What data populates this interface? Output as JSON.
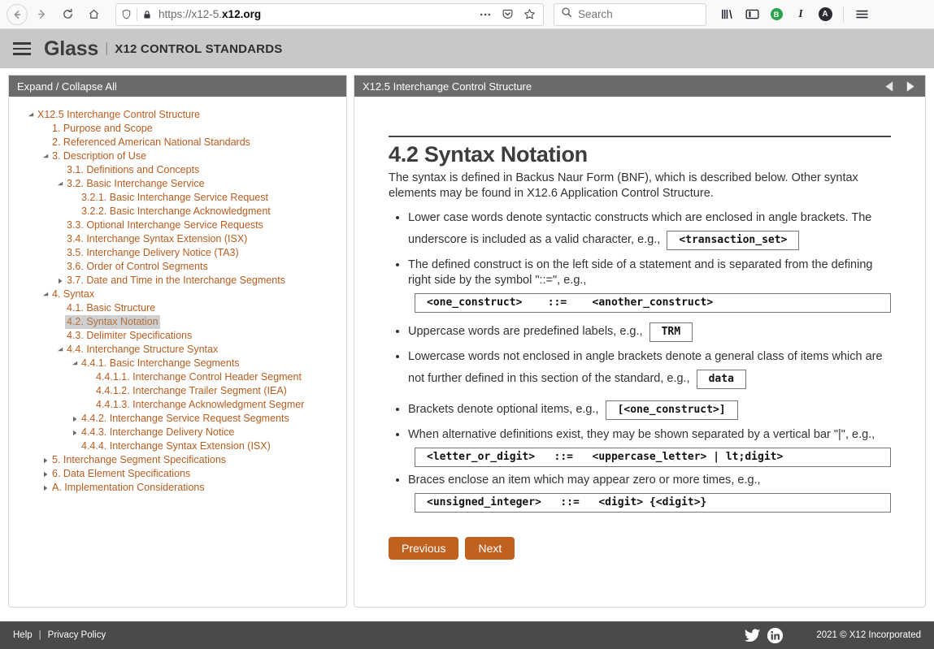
{
  "browser": {
    "back_icon": "back-arrow-icon",
    "forward_icon": "forward-arrow-icon",
    "reload_icon": "reload-icon",
    "home_icon": "home-icon",
    "shield_icon": "shield-icon",
    "lock_icon": "lock-icon",
    "url_prefix": "https://x12-5.",
    "url_bold": "x12.org",
    "page_actions_icon": "ellipsis-icon",
    "reader_save_icon": "pocket-icon",
    "bookmark_icon": "star-icon",
    "search_icon": "search-icon",
    "search_placeholder": "Search",
    "library_icon": "library-icon",
    "sidebars_icon": "sidebars-icon",
    "extension_badge": "B",
    "extension_badge_plus": "+",
    "italic_icon": "I",
    "account_icon": "A",
    "menu_icon": "hamburger-menu-icon"
  },
  "header": {
    "menu_icon": "hamburger-menu-icon",
    "brand": "Glass",
    "divider": "|",
    "subtitle": "X12 CONTROL STANDARDS"
  },
  "sidebar": {
    "title": "Expand / Collapse All",
    "items": [
      {
        "label": "X12.5 Interchange Control Structure",
        "indent": 0,
        "twisty": "expanded",
        "selected": false
      },
      {
        "label": "1. Purpose and Scope",
        "indent": 1,
        "twisty": "none",
        "selected": false
      },
      {
        "label": "2. Referenced American National Standards",
        "indent": 1,
        "twisty": "none",
        "selected": false
      },
      {
        "label": "3. Description of Use",
        "indent": 1,
        "twisty": "expanded",
        "selected": false
      },
      {
        "label": "3.1. Definitions and Concepts",
        "indent": 2,
        "twisty": "none",
        "selected": false
      },
      {
        "label": "3.2. Basic Interchange Service",
        "indent": 2,
        "twisty": "expanded",
        "selected": false
      },
      {
        "label": "3.2.1. Basic Interchange Service Request",
        "indent": 3,
        "twisty": "none",
        "selected": false
      },
      {
        "label": "3.2.2. Basic Interchange Acknowledgment",
        "indent": 3,
        "twisty": "none",
        "selected": false
      },
      {
        "label": "3.3. Optional Interchange Service Requests",
        "indent": 2,
        "twisty": "none",
        "selected": false
      },
      {
        "label": "3.4. Interchange Syntax Extension (ISX)",
        "indent": 2,
        "twisty": "none",
        "selected": false
      },
      {
        "label": "3.5. Interchange Delivery Notice (TA3)",
        "indent": 2,
        "twisty": "none",
        "selected": false
      },
      {
        "label": "3.6. Order of Control Segments",
        "indent": 2,
        "twisty": "none",
        "selected": false
      },
      {
        "label": "3.7. Date and Time in the Interchange Segments",
        "indent": 2,
        "twisty": "collapsed",
        "selected": false
      },
      {
        "label": "4. Syntax",
        "indent": 1,
        "twisty": "expanded",
        "selected": false
      },
      {
        "label": "4.1. Basic Structure",
        "indent": 2,
        "twisty": "none",
        "selected": false
      },
      {
        "label": "4.2. Syntax Notation",
        "indent": 2,
        "twisty": "none",
        "selected": true
      },
      {
        "label": "4.3. Delimiter Specifications",
        "indent": 2,
        "twisty": "none",
        "selected": false
      },
      {
        "label": "4.4. Interchange Structure Syntax",
        "indent": 2,
        "twisty": "expanded",
        "selected": false
      },
      {
        "label": "4.4.1. Basic Interchange Segments",
        "indent": 3,
        "twisty": "expanded",
        "selected": false
      },
      {
        "label": "4.4.1.1. Interchange Control Header Segment",
        "indent": 4,
        "twisty": "none",
        "selected": false
      },
      {
        "label": "4.4.1.2. Interchange Trailer Segment (IEA)",
        "indent": 4,
        "twisty": "none",
        "selected": false
      },
      {
        "label": "4.4.1.3. Interchange Acknowledgment Segmer",
        "indent": 4,
        "twisty": "none",
        "selected": false
      },
      {
        "label": "4.4.2. Interchange Service Request Segments",
        "indent": 3,
        "twisty": "collapsed",
        "selected": false
      },
      {
        "label": "4.4.3. Interchange Delivery Notice",
        "indent": 3,
        "twisty": "collapsed",
        "selected": false
      },
      {
        "label": "4.4.4. Interchange Syntax Extension (ISX)",
        "indent": 3,
        "twisty": "none",
        "selected": false
      },
      {
        "label": "5. Interchange Segment Specifications",
        "indent": 1,
        "twisty": "collapsed",
        "selected": false
      },
      {
        "label": "6. Data Element Specifications",
        "indent": 1,
        "twisty": "collapsed",
        "selected": false
      },
      {
        "label": "A. Implementation Considerations",
        "indent": 1,
        "twisty": "collapsed",
        "selected": false
      }
    ]
  },
  "content_panel": {
    "title": "X12.5 Interchange Control Structure",
    "prev_arrow_icon": "triangle-left-icon",
    "next_arrow_icon": "triangle-right-icon"
  },
  "document": {
    "heading": "4.2 Syntax Notation",
    "intro": "The syntax is defined in Backus Naur Form (BNF), which is described below. Other syntax elements may be found in X12.6 Application Control Structure.",
    "rules": [
      {
        "text": "Lower case words denote syntactic constructs which are enclosed in angle brackets. The underscore is included as a valid character, e.g.,",
        "code": "<transaction_set>",
        "full_width": false
      },
      {
        "text": "The defined construct is on the left side of a statement and is separated from the defining right side by the symbol \"::=\", e.g.,",
        "code": "<one_construct>    ::=    <another_construct>",
        "full_width": true
      },
      {
        "text": "Uppercase words are predefined labels, e.g.,",
        "code": "TRM",
        "full_width": false
      },
      {
        "text": "Lowercase words not enclosed in angle brackets denote a general class of items which are not further defined in this section of the standard, e.g.,",
        "code": "data",
        "full_width": false
      },
      {
        "text": "Brackets denote optional items, e.g.,",
        "code": "[<one_construct>]",
        "full_width": false
      },
      {
        "text": "When alternative definitions exist, they may be shown separated by a vertical bar \"|\", e.g.,",
        "code": "<letter_or_digit>   ::=   <uppercase_letter> | lt;digit>",
        "full_width": true
      },
      {
        "text": "Braces enclose an item which may appear zero or more times, e.g.,",
        "code": "<unsigned_integer>   ::=   <digit> {<digit>}",
        "full_width": true
      }
    ],
    "previous_label": "Previous",
    "next_label": "Next"
  },
  "footer": {
    "help_label": "Help",
    "separator": "|",
    "privacy_label": "Privacy Policy",
    "twitter_icon": "twitter-icon",
    "linkedin_icon": "linkedin-icon",
    "copyright": "2021 © X12 Incorporated"
  },
  "colors": {
    "accent_orange": "#c1611f",
    "tree_link": "#b95c1e",
    "panel_header": "#6b6b6b",
    "site_header": "#c8c8c8",
    "footer": "#4a4a4a"
  }
}
